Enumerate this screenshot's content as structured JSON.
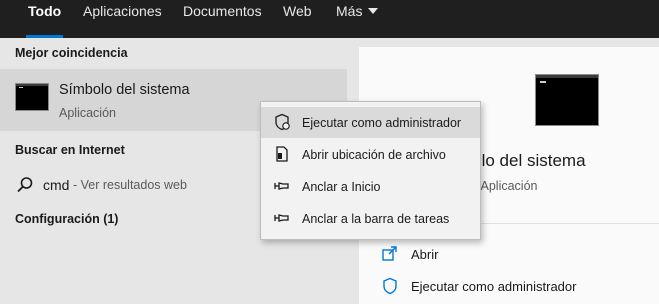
{
  "tabs": [
    {
      "label": "Todo",
      "active": true
    },
    {
      "label": "Aplicaciones"
    },
    {
      "label": "Documentos"
    },
    {
      "label": "Web"
    },
    {
      "label": "Más"
    }
  ],
  "left": {
    "best_match_heading": "Mejor coincidencia",
    "best_match": {
      "title": "Símbolo del sistema",
      "subtitle": "Aplicación",
      "icon": "cmd-icon"
    },
    "internet_heading": "Buscar en Internet",
    "web_search": {
      "query": "cmd",
      "hint": "- Ver resultados web",
      "icon": "search-icon"
    },
    "settings_heading": "Configuración (1)"
  },
  "context_menu": {
    "items": [
      {
        "label": "Ejecutar como administrador",
        "icon": "shield-icon"
      },
      {
        "label": "Abrir ubicación de archivo",
        "icon": "file-location-icon"
      },
      {
        "label": "Anclar a Inicio",
        "icon": "pin-icon"
      },
      {
        "label": "Anclar a la barra de tareas",
        "icon": "pin-icon"
      }
    ]
  },
  "detail": {
    "title": "Símbolo del sistema",
    "subtitle": "Aplicación",
    "actions": [
      {
        "label": "Abrir",
        "icon": "open-icon"
      },
      {
        "label": "Ejecutar como administrador",
        "icon": "shield-icon"
      }
    ]
  },
  "colors": {
    "accent": "#0078d7",
    "topbar": "#1f1f1f",
    "hover": "#dadada"
  }
}
